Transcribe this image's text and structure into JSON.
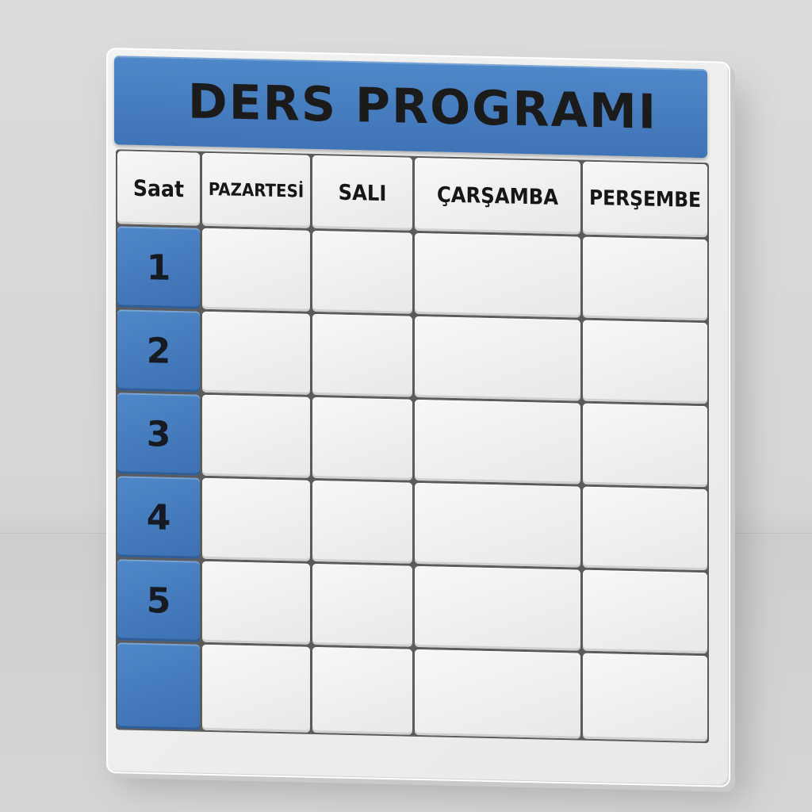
{
  "schedule": {
    "title": "DERS PROGRAMI",
    "headers": [
      "Saat",
      "PAZARTESİ",
      "SALI",
      "ÇARŞAMBA",
      "PERŞEMBE"
    ],
    "periods": [
      "1",
      "2",
      "3",
      "4",
      "5",
      ""
    ],
    "colors": {
      "accent": "#4a7fc1",
      "board": "#eeeeed",
      "text": "#1b1b1b"
    }
  }
}
